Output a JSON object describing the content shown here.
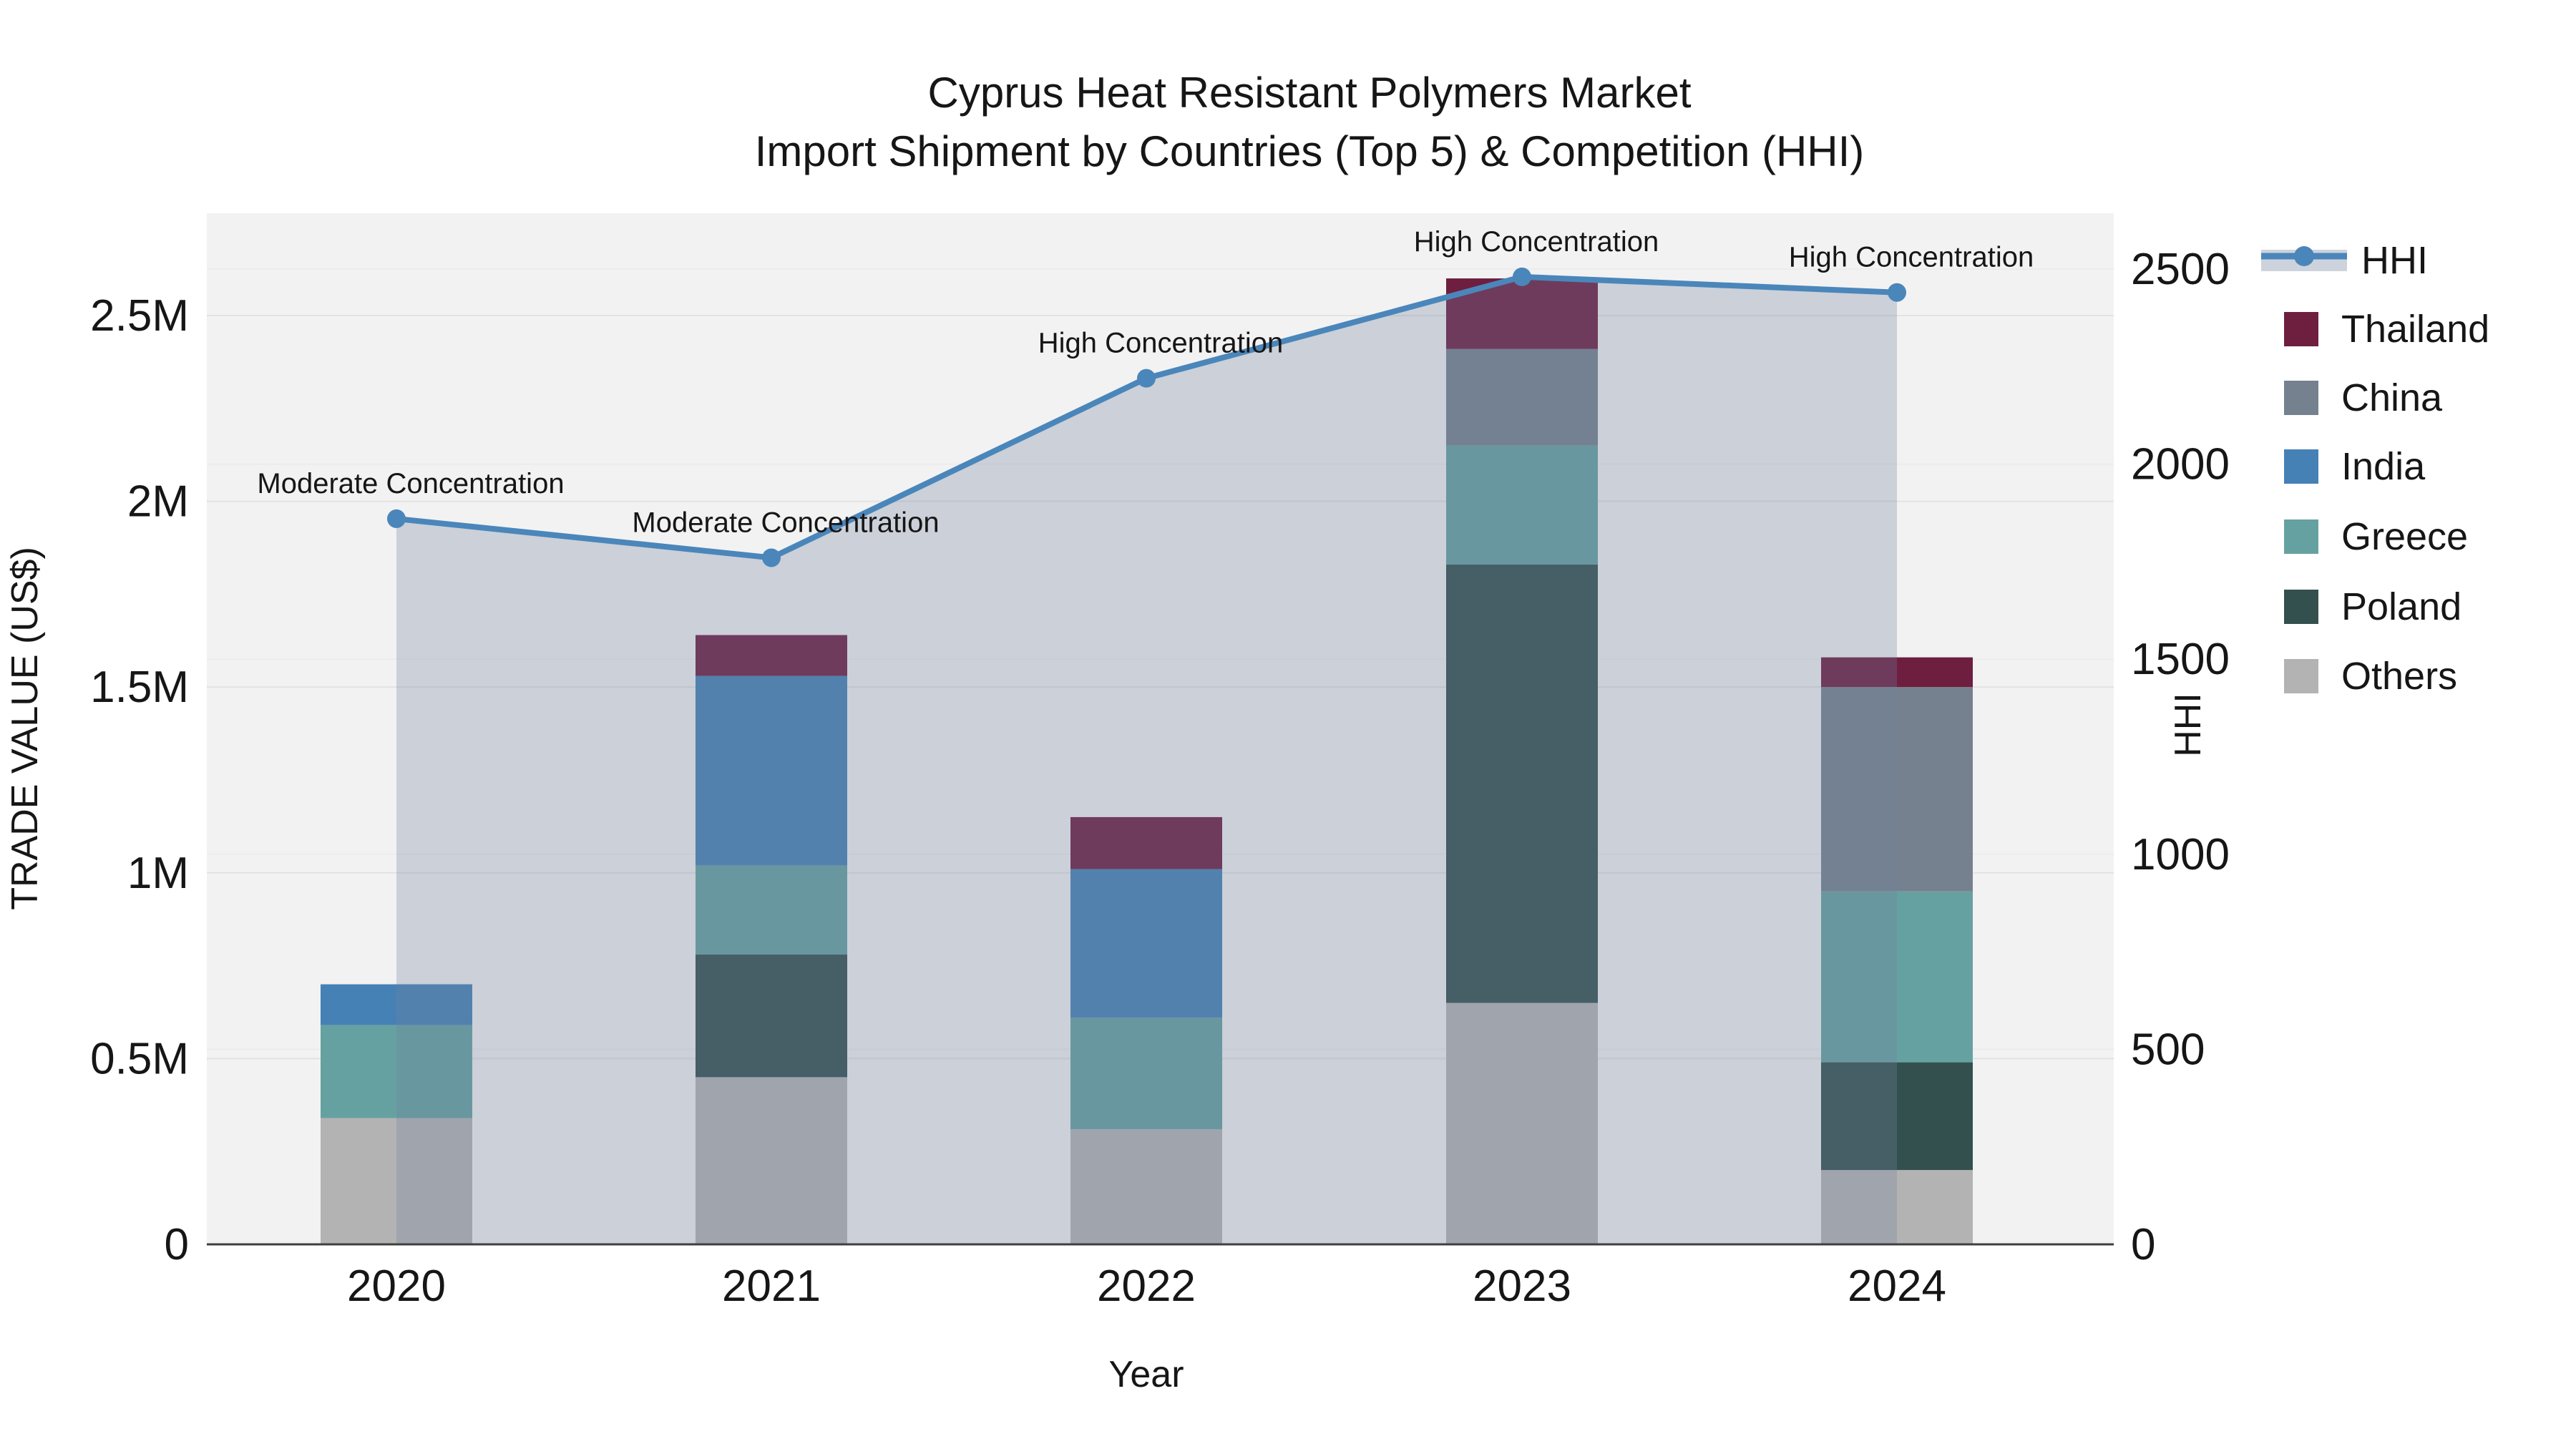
{
  "title": {
    "line1": "Cyprus Heat Resistant Polymers Market",
    "line2": "Import Shipment by Countries (Top 5) & Competition (HHI)"
  },
  "chart_data": {
    "type": "combo_stacked_bar_line",
    "categories": [
      "2020",
      "2021",
      "2022",
      "2023",
      "2024"
    ],
    "bar_value_unit": "US$ millions",
    "stack_order_bottom_to_top": [
      "Others",
      "Poland",
      "Greece",
      "India",
      "China",
      "Thailand"
    ],
    "series": [
      {
        "name": "Others",
        "color": "#b3b3b3",
        "values": [
          0.34,
          0.45,
          0.31,
          0.65,
          0.2
        ]
      },
      {
        "name": "Poland",
        "color": "#34504e",
        "values": [
          0,
          0.33,
          0,
          1.18,
          0.29
        ]
      },
      {
        "name": "Greece",
        "color": "#66a1a1",
        "values": [
          0.25,
          0.24,
          0.3,
          0.32,
          0.46
        ]
      },
      {
        "name": "India",
        "color": "#4581b5",
        "values": [
          0.11,
          0.51,
          0.4,
          0,
          0
        ]
      },
      {
        "name": "China",
        "color": "#75818e",
        "values": [
          0,
          0,
          0,
          0.26,
          0.55
        ]
      },
      {
        "name": "Thailand",
        "color": "#6e1e3f",
        "values": [
          0,
          0.11,
          0.14,
          0.19,
          0.08
        ]
      }
    ],
    "line": {
      "name": "HHI",
      "color": "#4a86ba",
      "area_fill": "rgba(112,128,160,0.30)",
      "legend_band_color": "#cdd3dc",
      "values": [
        1860,
        1760,
        2220,
        2480,
        2440
      ]
    },
    "annotations": [
      "Moderate Concentration",
      "Moderate Concentration",
      "High Concentration",
      "High Concentration",
      "High Concentration"
    ],
    "x_axis": {
      "title": "Year"
    },
    "left_axis": {
      "title": "TRADE VALUE (US$)",
      "ticks": [
        0,
        0.5,
        1,
        1.5,
        2,
        2.5
      ],
      "tick_labels": [
        "0",
        "0.5M",
        "1M",
        "1.5M",
        "2M",
        "2.5M"
      ],
      "range_max_millions": 2.78
    },
    "right_axis": {
      "title": "HHI",
      "ticks": [
        0,
        500,
        1000,
        1500,
        2000,
        2500
      ],
      "tick_labels": [
        "0",
        "500",
        "1000",
        "1500",
        "2000",
        "2500"
      ],
      "range_max": 2643
    },
    "legend_order": [
      "HHI",
      "Thailand",
      "China",
      "India",
      "Greece",
      "Poland",
      "Others"
    ],
    "grid": true,
    "legend_position": "right",
    "plot_background": "#f2f2f3",
    "gridline_color_left": "#e2e2e2",
    "gridline_color_right": "#ececec",
    "axis_line_color": "#3f3f3f"
  }
}
